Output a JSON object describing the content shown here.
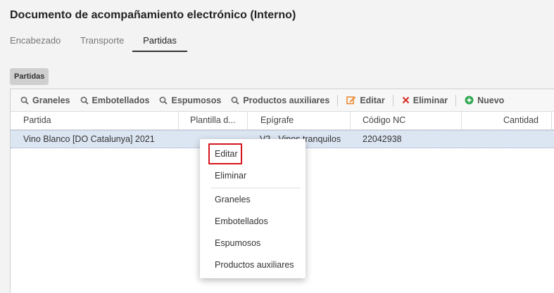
{
  "page": {
    "title": "Documento de acompañamiento electrónico (Interno)"
  },
  "tabs": [
    {
      "label": "Encabezado",
      "active": false
    },
    {
      "label": "Transporte",
      "active": false
    },
    {
      "label": "Partidas",
      "active": true
    }
  ],
  "section": {
    "label": "Partidas"
  },
  "toolbar": {
    "graneles": "Graneles",
    "embotellados": "Embotellados",
    "espumosos": "Espumosos",
    "productos_auxiliares": "Productos auxiliares",
    "editar": "Editar",
    "eliminar": "Eliminar",
    "nuevo": "Nuevo"
  },
  "table": {
    "columns": [
      "Partida",
      "Plantilla d...",
      "Epígrafe",
      "Código NC",
      "Cantidad"
    ],
    "rows": [
      {
        "partida": "Vino Blanco [DO Catalunya] 2021",
        "plantilla": "",
        "epigrafe": "V2 - Vinos tranquilos",
        "codigo_nc": "22042938",
        "cantidad": ""
      }
    ]
  },
  "context_menu": {
    "items": [
      "Editar",
      "Eliminar",
      "Graneles",
      "Embotellados",
      "Espumosos",
      "Productos auxiliares"
    ],
    "highlighted": "Editar"
  },
  "colors": {
    "selected_row": "#dce6f2",
    "highlight_border": "#d6141c",
    "editar_icon": "#e8862c",
    "eliminar_icon": "#d9302c",
    "nuevo_icon": "#2fa84f"
  }
}
